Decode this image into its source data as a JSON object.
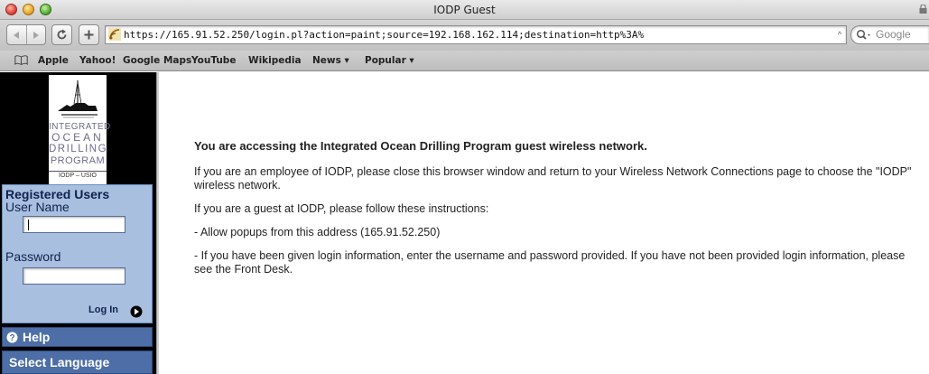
{
  "window": {
    "title": "IODP Guest"
  },
  "toolbar": {
    "back_icon": "back-arrow-icon",
    "forward_icon": "forward-arrow-icon",
    "reload_icon": "reload-icon",
    "add_icon": "plus-icon",
    "url": "https://165.91.52.250/login.pl?action=paint;source=192.168.162.114;destination=http%3A%",
    "search_placeholder": "Google"
  },
  "bookmarks": {
    "items": [
      "Apple",
      "Yahoo!",
      "Google Maps",
      "YouTube",
      "Wikipedia",
      "News ▾",
      "Popular ▾"
    ]
  },
  "sidebar": {
    "logo": {
      "lines": [
        "INTEGRATED",
        "OCEAN",
        "DRILLING",
        "PROGRAM"
      ],
      "caption": "IODP – USIO"
    },
    "login": {
      "heading": "Registered Users",
      "username_label": "User Name",
      "username_value": "",
      "password_label": "Password",
      "password_value": "",
      "button_label": "Log In"
    },
    "help_label": "Help",
    "language_label": "Select Language"
  },
  "content": {
    "heading": "You are accessing the Integrated Ocean Drilling Program guest wireless network.",
    "paragraphs": [
      "If you are an employee of IODP, please close this browser window and return to your Wireless Network Connections page to choose the \"IODP\" wireless network.",
      "If you are a guest at IODP, please follow these instructions:",
      "- Allow popups from this address (165.91.52.250)",
      "- If you have been given login information, enter the username and password provided. If you have not been provided login information, please see the Front Desk."
    ]
  },
  "colors": {
    "sidebar_bg": "#000000",
    "login_panel_bg": "#a8bfe0",
    "nav_bar_bg": "#4d6ea6",
    "heading_text": "#10224d"
  }
}
